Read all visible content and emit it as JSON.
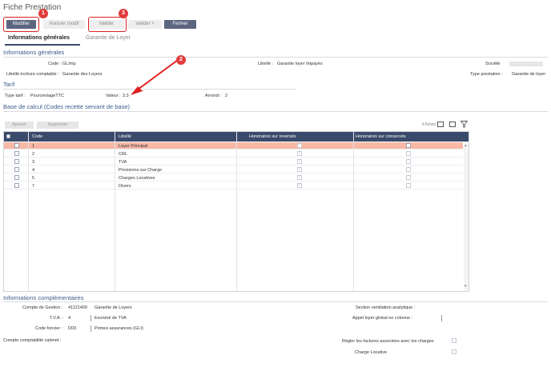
{
  "title": "Fiche Prestation",
  "toolbar": {
    "modifier": "Modifier",
    "annuler": "Annuler modif",
    "valider": "Valider",
    "valider_plus": "Valider +",
    "fermer": "Fermer"
  },
  "badges": [
    "1",
    "2",
    "3"
  ],
  "tabs": [
    "Informations générales",
    "Garantie de Loyer"
  ],
  "info": {
    "section": "Informations générales",
    "code_label": "Code :",
    "code_value": "GLImp",
    "libelle_label": "Libellé :",
    "libelle_value": "Garantie loyer Impayés",
    "societe_label": "Société",
    "libelle_ecriture_label": "Libellé écriture comptable :",
    "libelle_ecriture_value": "Garantie des Loyers",
    "type_prestation_label": "Type prestation :",
    "type_prestation_value": "Garantie de loyer"
  },
  "tarif": {
    "section": "Tarif",
    "type_label": "Type tarif :",
    "type_value": "PourcentageTTC",
    "valeur_label": "Valeur :",
    "valeur_value": "3.3",
    "arrondi_label": "Arrondi :",
    "arrondi_value": "2"
  },
  "base": {
    "section": "Base de calcul (Codes recette servant de base)",
    "ajouter": "Ajouter",
    "supprimer": "Supprimer",
    "count": "6 fiches",
    "columns": [
      "Code",
      "Libellé",
      "Honoraires sur reversés",
      "Honoraires sur conservés"
    ],
    "rows": [
      {
        "code": "1",
        "libelle": "Loyer Principal",
        "reverses": true,
        "conserves": false
      },
      {
        "code": "2",
        "libelle": "CRL",
        "reverses": true,
        "conserves": false
      },
      {
        "code": "3",
        "libelle": "TVA",
        "reverses": true,
        "conserves": false
      },
      {
        "code": "4",
        "libelle": "Provisions sur Charge",
        "reverses": true,
        "conserves": false
      },
      {
        "code": "5",
        "libelle": "Charges Locatives",
        "reverses": true,
        "conserves": false
      },
      {
        "code": "7",
        "libelle": "Divers",
        "reverses": true,
        "conserves": false
      }
    ]
  },
  "complement": {
    "section": "Informations complémentaires",
    "compte_gestion_label": "Compte de Gestion :",
    "compte_gestion_code": "41121400",
    "compte_gestion_value": "Garantie de Loyers",
    "tva_label": "T.V.A. :",
    "tva_code": "4",
    "tva_value": "Exonéré de TVA",
    "code_foncier_label": "Code foncier :",
    "code_foncier_code": "D03",
    "code_foncier_value": "Primes assurances (GLI)",
    "compte_cabinet_label": "Compte comptabilité cabinet :",
    "section_ventilation_label": "Section ventilation analytique :",
    "appel_loyer_label": "Appel loyer global no colonne :",
    "regler_label": "Régler les factures associées avec les charges",
    "charge_locative_label": "Charge Locative"
  }
}
